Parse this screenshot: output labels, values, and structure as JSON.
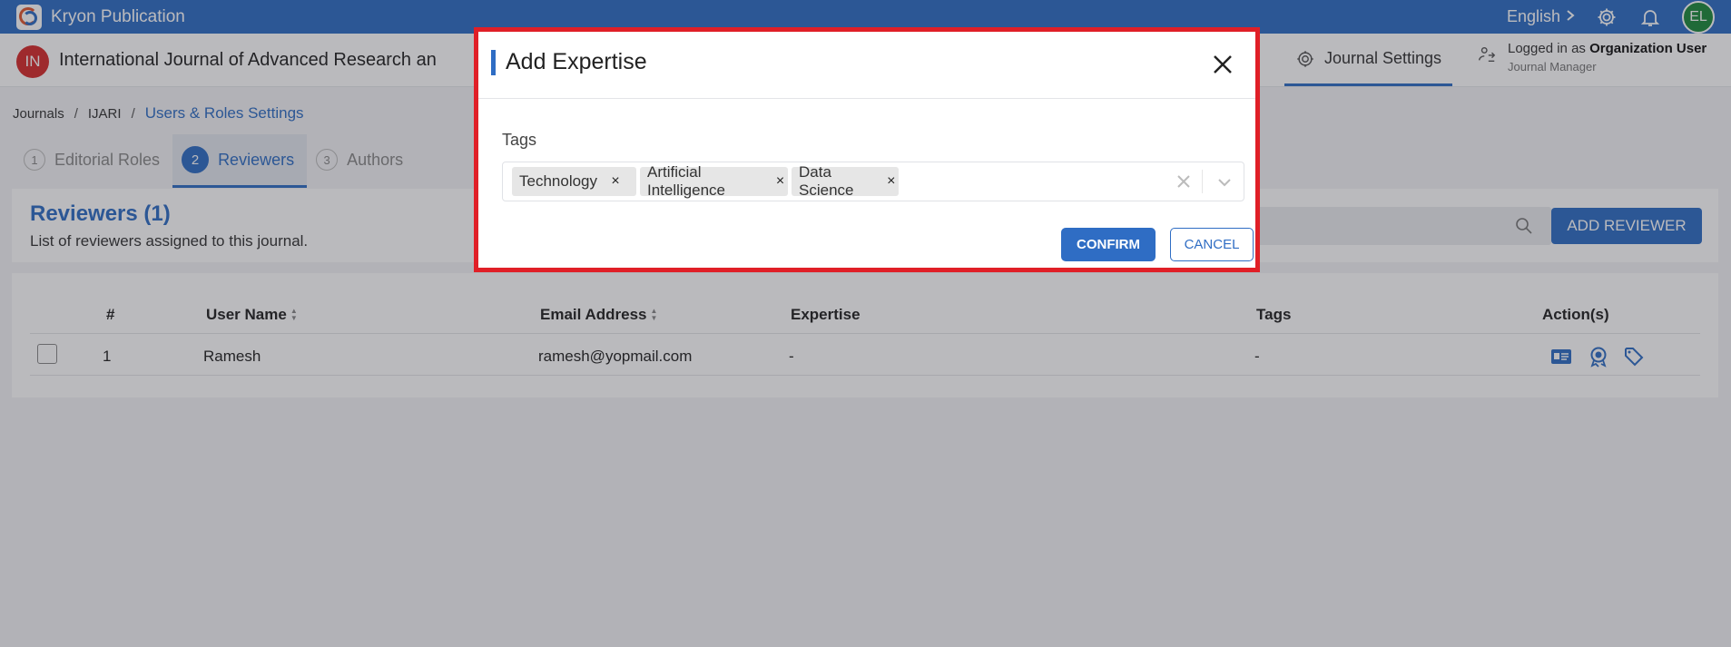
{
  "topbar": {
    "brand": "Kryon Publication",
    "language": "English",
    "avatar_initials": "EL",
    "color": "#2f6dc4"
  },
  "journal": {
    "badge": "IN",
    "title": "International Journal of Advanced Research an",
    "settings_label": "Journal Settings",
    "logged_prefix": "Logged in as",
    "logged_user": "Organization User",
    "role": "Journal Manager"
  },
  "breadcrumb": {
    "items": [
      "Journals",
      "IJARI",
      "Users & Roles Settings"
    ],
    "separator": "/"
  },
  "tabs": [
    {
      "num": "1",
      "label": "Editorial Roles"
    },
    {
      "num": "2",
      "label": "Reviewers"
    },
    {
      "num": "3",
      "label": "Authors"
    }
  ],
  "reviewers_panel": {
    "title": "Reviewers (1)",
    "subtitle": "List of reviewers assigned to this journal.",
    "add_button": "ADD REVIEWER"
  },
  "table": {
    "headers": [
      "#",
      "User Name",
      "Email Address",
      "Expertise",
      "Tags",
      "Action(s)"
    ],
    "rows": [
      {
        "index": "1",
        "user_name": "Ramesh",
        "email": "ramesh@yopmail.com",
        "expertise": "-",
        "tags": "-"
      }
    ],
    "action_icons": [
      "id-card-icon",
      "award-icon",
      "tag-icon"
    ]
  },
  "modal": {
    "title": "Add Expertise",
    "field_label": "Tags",
    "tags": [
      "Technology",
      "Artificial Intelligence",
      "Data Science"
    ],
    "tag_remove": "×",
    "confirm": "CONFIRM",
    "cancel": "CANCEL",
    "highlight_color": "#e01f27"
  }
}
